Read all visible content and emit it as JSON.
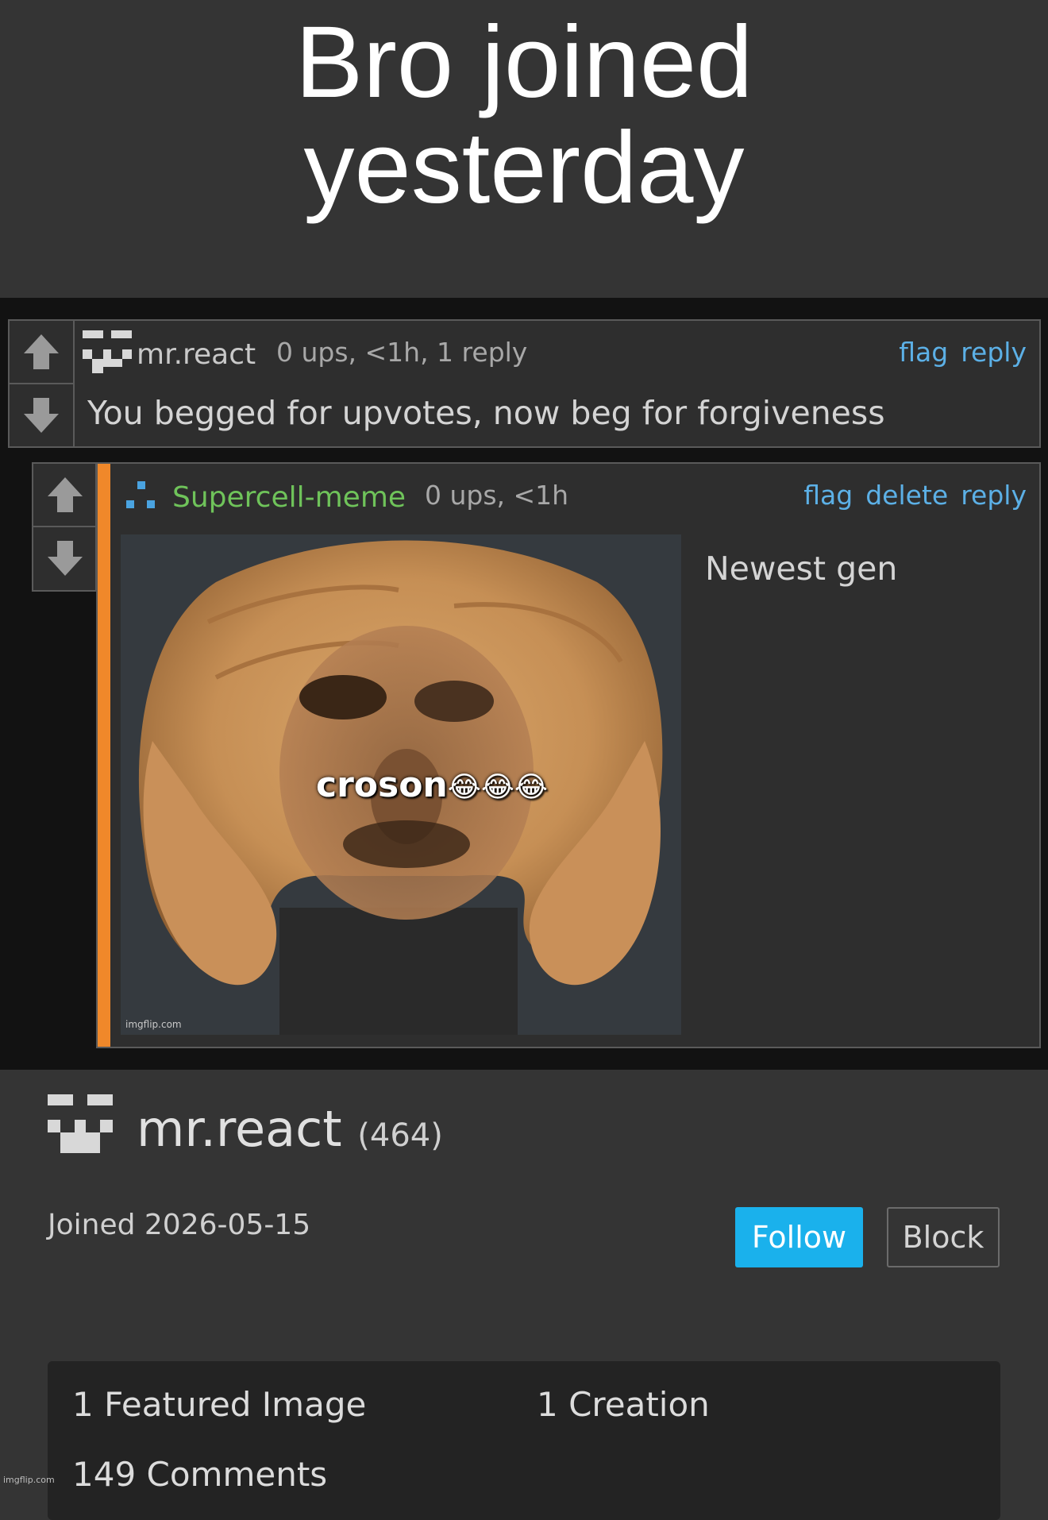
{
  "caption": {
    "text": "Bro joined\nyesterday"
  },
  "comments": [
    {
      "username": "mr.react",
      "meta": "0 ups, <1h, 1 reply",
      "actions": [
        "flag",
        "reply"
      ],
      "text": "You begged for upvotes, now beg for forgiveness"
    },
    {
      "username": "Supercell-meme",
      "meta": "0 ups, <1h",
      "actions": [
        "flag",
        "delete",
        "reply"
      ],
      "text": "Newest gen",
      "image": {
        "overlay_text": "croson",
        "emoji": "😂😂😂",
        "watermark": "imgflip.com"
      }
    }
  ],
  "profile": {
    "username": "mr.react",
    "points": "(464)",
    "joined": "Joined 2026-05-15",
    "follow_label": "Follow",
    "block_label": "Block",
    "stats": [
      "1 Featured Image",
      "1 Creation",
      "149 Comments"
    ]
  },
  "colors": {
    "accent_link": "#5cb0e6",
    "follow_button": "#1ab1ec",
    "reply_bar": "#f0882a",
    "username_green": "#6fc35a"
  },
  "watermark": "imgflip.com"
}
